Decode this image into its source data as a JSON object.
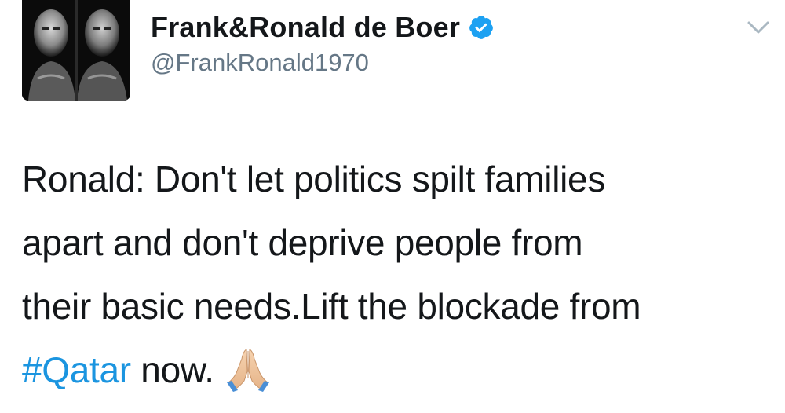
{
  "tweet": {
    "display_name": "Frank&Ronald de Boer",
    "handle": "@FrankRonald1970",
    "verified": true,
    "avatar_icon": "twin-portrait-avatar",
    "menu_icon": "chevron-down-icon",
    "text_lines": [
      "Ronald: Don't let politics spilt families",
      "apart and don't deprive people from",
      "their basic needs.Lift the blockade from"
    ],
    "hashtag": "#Qatar",
    "text_tail": " now.",
    "emoji": "folded-hands-emoji"
  },
  "colors": {
    "text": "#14171a",
    "handle": "#657786",
    "link": "#1b95e0",
    "verified_badge": "#1da1f2",
    "chevron": "#aab8c2"
  }
}
